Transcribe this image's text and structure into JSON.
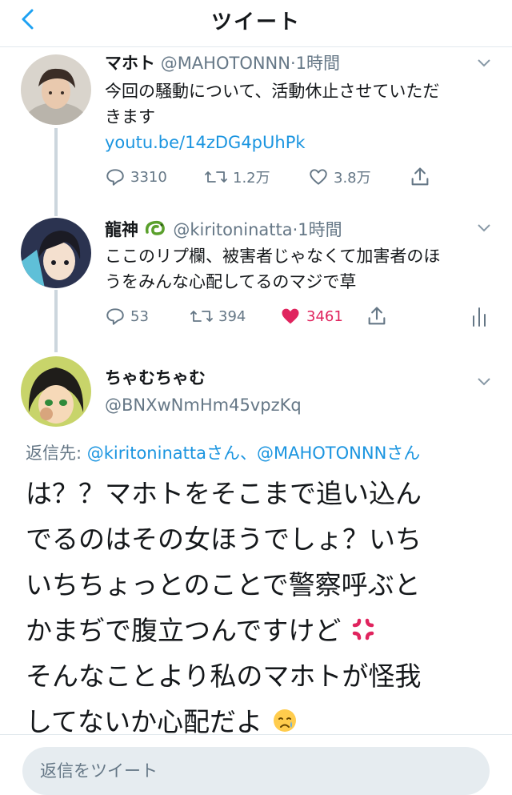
{
  "header": {
    "title": "ツイート",
    "back_icon": "chevron-left-icon"
  },
  "tweets": [
    {
      "name": "マホト",
      "handle": "@MAHOTONNN",
      "sep": "·",
      "time": "1時間",
      "text_line1": "今回の騒動について、活動休止させていただ",
      "text_line2": "きます",
      "link": "youtu.be/14zDG4pUhPk",
      "replies": "3310",
      "retweets": "1.2万",
      "likes": "3.8万"
    },
    {
      "name": "龍神",
      "handle": "@kiritoninatta",
      "sep": "·",
      "time": "1時間",
      "text_line1": "ここのリプ欄、被害者じゃなくて加害者のほ",
      "text_line2": "うをみんな心配してるのマジで草",
      "replies": "53",
      "retweets": "394",
      "likes": "3461",
      "liked": true
    }
  ],
  "main_tweet": {
    "name": "ちゃむちゃむ",
    "handle": "@BNXwNmHm45vpzKq",
    "reply_prefix": "返信先: ",
    "mention1": "@kiritoninatta",
    "suffix1": "さん、",
    "mention2": "@MAHOTONNN",
    "suffix2": "さん",
    "line1": "は？？マホトをそこまで追い込ん",
    "line2": "でるのはその女ほうでしょ？いち",
    "line3": "いちちょっとのことで警察呼ぶと",
    "line4": "かまぢで腹立つんですけど",
    "line5": "そんなことより私のマホトが怪我",
    "line6": "してないか心配だよ"
  },
  "compose": {
    "placeholder": "返信をツイート"
  },
  "colors": {
    "link": "#1b95e0",
    "liked": "#e0245e",
    "muted": "#657786"
  }
}
